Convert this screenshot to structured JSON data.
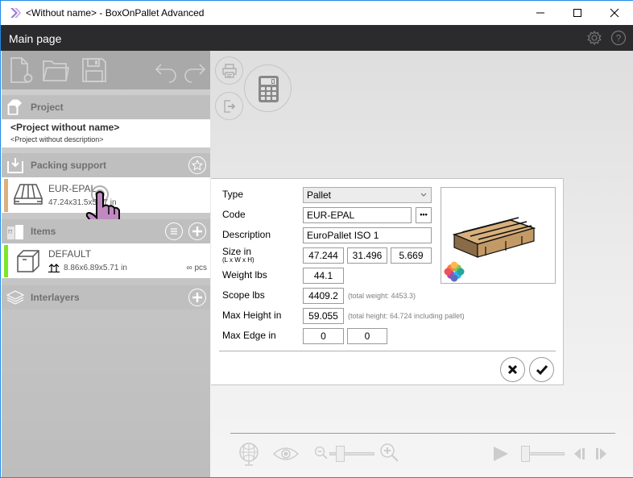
{
  "window": {
    "title": "<Without name> - BoxOnPallet Advanced",
    "controls": [
      "minimize",
      "maximize",
      "close"
    ]
  },
  "header": {
    "title": "Main page",
    "icons": [
      "gear-icon",
      "help-icon"
    ]
  },
  "toolbar": {
    "buttons": [
      "new-file",
      "open-folder",
      "save",
      "undo",
      "redo"
    ]
  },
  "actions": {
    "buttons": [
      "print",
      "export",
      "calculate"
    ]
  },
  "project": {
    "section_label": "Project",
    "name": "<Project without name>",
    "description": "<Project without description>"
  },
  "packing_support": {
    "section_label": "Packing support",
    "item": {
      "code": "EUR-EPAL",
      "size": "47.24x31.5x5.67 in",
      "color": "#d9b07f"
    }
  },
  "items": {
    "section_label": "Items",
    "list": [
      {
        "name": "DEFAULT",
        "size": "8.86x6.89x5.71 in",
        "qty": "∞ pcs",
        "color": "#7ce62a"
      }
    ]
  },
  "interlayers": {
    "section_label": "Interlayers"
  },
  "form": {
    "type_label": "Type",
    "type_value": "Pallet",
    "code_label": "Code",
    "code_value": "EUR-EPAL",
    "code_more": "•••",
    "description_label": "Description",
    "description_value": "EuroPallet ISO 1",
    "size_label": "Size in",
    "size_sub": "(L x W x H)",
    "size_l": "47.244",
    "size_w": "31.496",
    "size_h": "5.669",
    "weight_label": "Weight lbs",
    "weight_value": "44.1",
    "scope_label": "Scope lbs",
    "scope_value": "4409.2",
    "scope_hint": "(total weight: 4453.3)",
    "maxheight_label": "Max Height in",
    "maxheight_value": "59.055",
    "maxheight_hint": "(total height: 64.724 including pallet)",
    "maxedge_label": "Max Edge in",
    "maxedge_1": "0",
    "maxedge_2": "0"
  },
  "viewer": {
    "zoom_level": 0.15,
    "playback_position": 0.0
  }
}
